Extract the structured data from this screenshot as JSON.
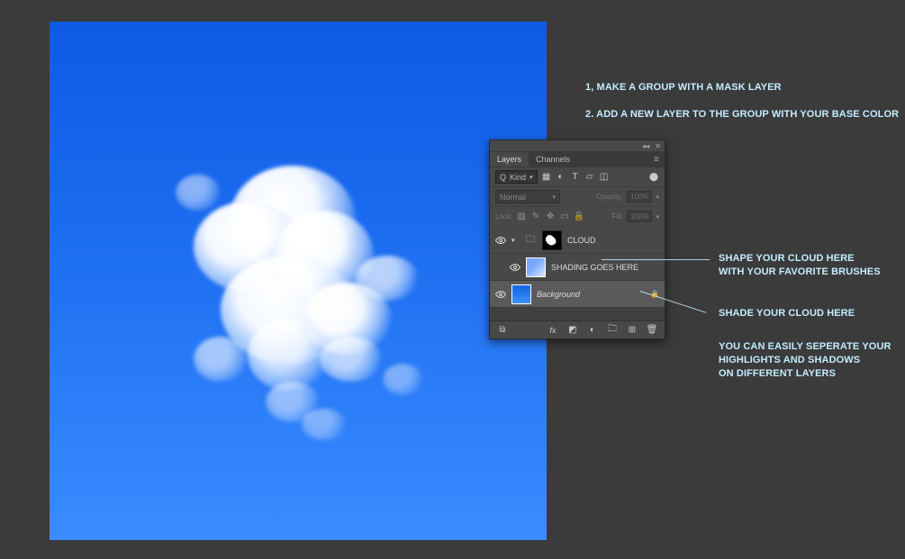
{
  "instructions": {
    "step1": "1, MAKE A GROUP WITH A MASK LAYER",
    "step2": "2. ADD A NEW LAYER TO THE GROUP WITH YOUR BASE COLOR"
  },
  "annotations": {
    "shape_line1": "SHAPE YOUR CLOUD HERE",
    "shape_line2": "WITH YOUR FAVORITE BRUSHES",
    "shade": "SHADE YOUR CLOUD HERE",
    "tip_line1": "YOU CAN EASILY SEPERATE YOUR",
    "tip_line2": "HIGHLIGHTS AND SHADOWS",
    "tip_line3": "ON DIFFERENT LAYERS"
  },
  "panel": {
    "tabs": {
      "layers": "Layers",
      "channels": "Channels"
    },
    "filter": {
      "kind": "Kind"
    },
    "blend_mode": "Normal",
    "opacity_label": "Opacity:",
    "opacity_value": "100%",
    "lock_label": "Lock:",
    "fill_label": "Fill:",
    "fill_value": "100%",
    "layers": [
      {
        "name": "CLOUD"
      },
      {
        "name": "SHADING GOES HERE"
      },
      {
        "name": "Background"
      }
    ]
  },
  "search_prefix": "Q"
}
